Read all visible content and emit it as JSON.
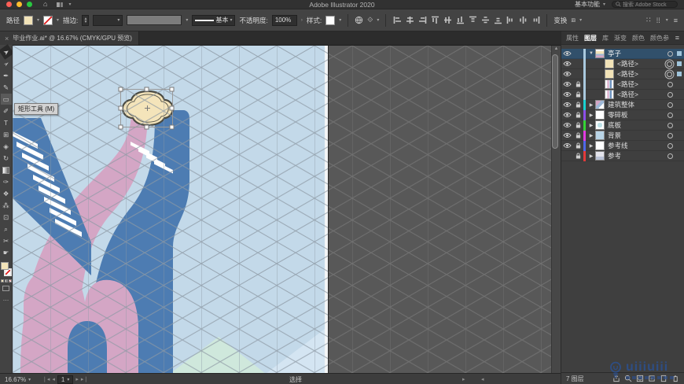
{
  "menu_bar": {
    "title": "Adobe Illustrator 2020",
    "workspace": "基本功能",
    "search_placeholder": "搜索 Adobe Stock"
  },
  "control_bar": {
    "context_label": "路径",
    "stroke_label": "描边:",
    "line_style_label": "基本",
    "opacity_label": "不透明度:",
    "opacity_value": "100%",
    "style_label": "样式:",
    "transform_label": "变换",
    "align_icons": [
      "align-horizontal-left",
      "align-horizontal-center",
      "align-horizontal-right",
      "align-vertical-top",
      "align-vertical-center",
      "align-vertical-bottom",
      "distribute-vertical-top",
      "distribute-vertical-center",
      "distribute-vertical-bottom",
      "distribute-horizontal-left",
      "distribute-horizontal-center",
      "distribute-horizontal-right"
    ]
  },
  "document_tab": {
    "close": "×",
    "title": "毕业作业.ai* @ 16.67% (CMYK/GPU 预览)"
  },
  "tooltip": "矩形工具 (M)",
  "tools": [
    {
      "name": "selection-tool",
      "glyph": "➤",
      "state": "active",
      "rot": true
    },
    {
      "name": "direct-selection-tool",
      "glyph": "➢",
      "rot": true
    },
    {
      "name": "pen-tool",
      "glyph": "✒"
    },
    {
      "name": "curvature-tool",
      "glyph": "✎"
    },
    {
      "name": "rectangle-tool",
      "glyph": "▭",
      "state": "hover"
    },
    {
      "name": "paintbrush-tool",
      "glyph": "✐"
    },
    {
      "name": "type-tool",
      "glyph": "T"
    },
    {
      "name": "shape-builder-tool",
      "glyph": "⊞"
    },
    {
      "name": "shaper-tool",
      "glyph": "◈"
    },
    {
      "name": "rotate-tool",
      "glyph": "↻"
    },
    {
      "name": "gradient-tool",
      "glyph": "",
      "gradient": true
    },
    {
      "name": "eyedropper-tool",
      "glyph": "✑"
    },
    {
      "name": "blend-tool",
      "glyph": "❖"
    },
    {
      "name": "symbol-sprayer-tool",
      "glyph": "⁂"
    },
    {
      "name": "artboard-tool",
      "glyph": "⊡"
    },
    {
      "name": "zoom-tool",
      "glyph": "⌕"
    },
    {
      "name": "scissors-tool",
      "glyph": "✂"
    },
    {
      "name": "hand-tool",
      "glyph": "☛"
    }
  ],
  "panel": {
    "tabs": [
      {
        "label": "属性",
        "active": false
      },
      {
        "label": "图层",
        "active": true
      },
      {
        "label": "库",
        "active": false
      },
      {
        "label": "渐变",
        "active": false
      },
      {
        "label": "颜色",
        "active": false
      },
      {
        "label": "颜色参",
        "active": false
      }
    ],
    "layers": [
      {
        "name": "亭子",
        "visible": true,
        "locked": false,
        "expanded": true,
        "indent": 0,
        "thumb": "group",
        "bar": "#a9c9de",
        "target": "ring",
        "selected_square": true,
        "row_selected": true
      },
      {
        "name": "<路径>",
        "visible": true,
        "locked": false,
        "indent": 1,
        "thumb": "cream",
        "bar": "#a9c9de",
        "target": "double",
        "selected_square": true
      },
      {
        "name": "<路径>",
        "visible": true,
        "locked": false,
        "indent": 1,
        "thumb": "cream",
        "bar": "#a9c9de",
        "target": "double",
        "selected_square": true
      },
      {
        "name": "<路径>",
        "visible": true,
        "locked": true,
        "indent": 1,
        "thumb": "pillars",
        "bar": "#a9c9de",
        "target": "ring",
        "selected_square": false
      },
      {
        "name": "<路径>",
        "visible": true,
        "locked": true,
        "indent": 1,
        "thumb": "pillars",
        "bar": "#a9c9de",
        "target": "ring",
        "selected_square": false
      },
      {
        "name": "建筑整体",
        "visible": true,
        "locked": true,
        "expandable": true,
        "indent": 0,
        "thumb": "building",
        "bar": "#19d1d1",
        "target": "ring",
        "selected_square": false
      },
      {
        "name": "零碎板",
        "visible": true,
        "locked": true,
        "expandable": true,
        "indent": 0,
        "thumb": "white",
        "bar": "#8c4fe8",
        "target": "ring",
        "selected_square": false
      },
      {
        "name": "底板",
        "visible": true,
        "locked": true,
        "expandable": true,
        "indent": 0,
        "thumb": "mint",
        "bar": "#35d435",
        "target": "ring",
        "selected_square": false
      },
      {
        "name": "背景",
        "visible": true,
        "locked": true,
        "expandable": true,
        "indent": 0,
        "thumb": "lightblue",
        "bar": "#e23ae2",
        "target": "ring",
        "selected_square": false
      },
      {
        "name": "参考线",
        "visible": true,
        "locked": true,
        "expandable": true,
        "indent": 0,
        "thumb": "white",
        "bar": "#4f68e8",
        "target": "ring",
        "selected_square": false
      },
      {
        "name": "参考",
        "visible": false,
        "locked": true,
        "expandable": true,
        "indent": 0,
        "thumb": "reference",
        "bar": "#e23a3a",
        "target": "ring",
        "selected_square": false
      }
    ],
    "footer_count": "7 图层"
  },
  "status_bar": {
    "zoom": "16.67%",
    "artboard": "1",
    "tool": "选择"
  },
  "watermark": {
    "text": "uiiiuiii"
  },
  "artwork_colors": {
    "background": "#c3d9e9",
    "pink": "#d4a6c5",
    "blue": "#4d7cb2",
    "cream": "#f4e4ba",
    "cloud_stroke": "#4b4b43",
    "mint": "#cfe8dc",
    "pale_blue": "#d4e5f2",
    "pasteboard": "#585858"
  }
}
